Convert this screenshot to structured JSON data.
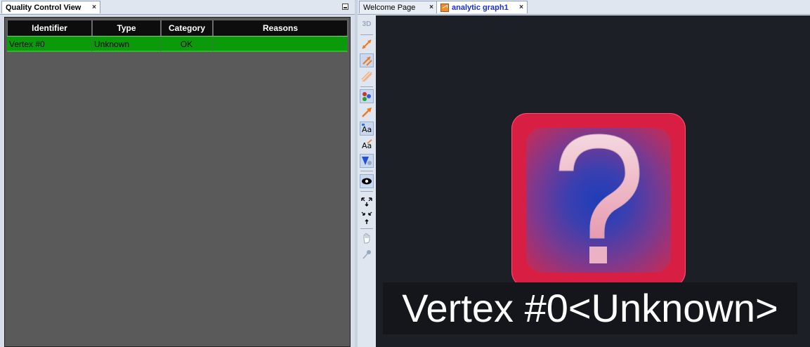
{
  "left_panel": {
    "tab_title": "Quality Control View",
    "tab_close": "×",
    "table": {
      "columns": [
        "Identifier",
        "Type",
        "Category",
        "Reasons"
      ],
      "rows": [
        {
          "identifier": "Vertex #0",
          "type": "Unknown",
          "category": "OK",
          "reasons": ""
        }
      ],
      "row_color": "#0a9a0a"
    }
  },
  "right_panel": {
    "tabs": [
      {
        "label": "Welcome Page",
        "close": "×"
      },
      {
        "label": "analytic graph1",
        "close": "×",
        "icon": "graph-icon",
        "active": true
      }
    ],
    "toolbar": {
      "toggle_3d_label": "3D",
      "buttons": [
        "display-3d",
        "show-transactions-icon",
        "select-transactions-icon",
        "hide-transactions-icon",
        "node-colors-icon",
        "connection-mode-icon",
        "node-labels-icon",
        "connection-labels-icon",
        "blazes-icon",
        "visibility-icon",
        "zoom-expand-collapse-icon",
        "pan-hand-icon",
        "pin-icon"
      ]
    },
    "graph": {
      "background": "#1d1f27",
      "node_color": "#d81f43",
      "node_glyph": "question-mark-icon",
      "node_label": "Vertex #0<Unknown>"
    }
  }
}
